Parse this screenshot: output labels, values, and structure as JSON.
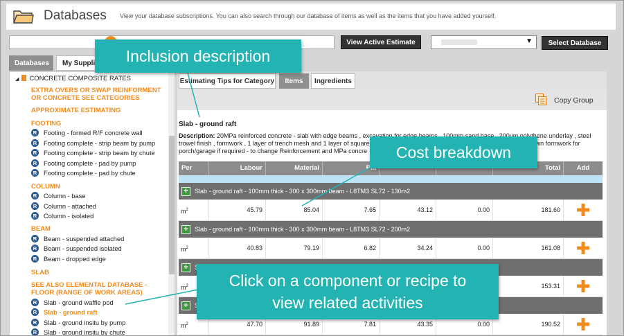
{
  "header": {
    "title": "Databases",
    "description": "View your database subscriptions. You can also search through our database of items as well as the items that you have added yourself."
  },
  "toolbar": {
    "view_estimate_label": "View Active Estimate",
    "select_db_label": "Select Database"
  },
  "left_tabs": {
    "databases": "Databases",
    "suppliers": "My Supplie"
  },
  "tree": {
    "root_label": "CONCRETE COMPOSITE RATES",
    "categories": {
      "extra_overs": "EXTRA OVERS OR SWAP REINFORMENT OR CONCRETE SEE CATEGORIES",
      "approx": "APPROXIMATE ESTIMATING",
      "footing": "FOOTING",
      "column": "COLUMN",
      "beam": "BEAM",
      "slab": "SLAB",
      "see_also": "SEE ALSO ELEMENTAL DATABASE - FLOOR (RANGE OF WORK AREAS)"
    },
    "recipe_badge": "R",
    "items": [
      "Footing - formed R/F concrete wall",
      "Footing complete - strip beam by pump",
      "Footing complete - strip beam by chute",
      "Footing complete - pad by pump",
      "Footing complete - pad by chute",
      "Column - base",
      "Column - attached",
      "Column - isolated",
      "Beam - suspended attached",
      "Beam - suspended isolated",
      "Beam - dropped edge",
      "Slab - ground waffle pod",
      "Slab - ground raft",
      "Slab - ground insitu by pump",
      "Slab - ground insitu by chute"
    ]
  },
  "right_tabs": {
    "tips": "Estimating Tips for Category",
    "items": "Items",
    "ingredients": "Ingredients"
  },
  "copy_group_label": "Copy Group",
  "selected_title": "Slab - ground raft",
  "description": {
    "label": "Description:",
    "line1": "20MPa reinforced concrete - slab with edge beams , excavation for edge beams , 100mm sand base , 200um polythene underlay , steel",
    "line2": "trowel finish , formwork , 1 layer of trench mesh and 1 layer of square",
    "line2_end": "wn formwork for",
    "line3": "porch/garage if required - to change Reinforcement and MPa concre"
  },
  "table": {
    "headers": {
      "per": "Per",
      "labour": "Labour",
      "material": "Material",
      "plant": "Pla",
      "total": "Total",
      "add": "Add"
    },
    "groups": [
      "Slab - ground raft - 100mm thick - 300 x 300mm beam - L8TM3 SL72 - 130m2",
      "Slab - ground raft - 100mm thick - 300 x 300mm beam - L8TM3 SL72 - 200m2",
      "S",
      "S"
    ],
    "unit": "m",
    "unit_sup": "2",
    "rows": [
      {
        "labour": "45.79",
        "material": "85.04",
        "plant": "7.65",
        "col4": "43.12",
        "col5": "0.00",
        "total": "181.60"
      },
      {
        "labour": "40.83",
        "material": "79.19",
        "plant": "6.82",
        "col4": "34.24",
        "col5": "0.00",
        "total": "161.08"
      },
      {
        "labour": "",
        "material": "",
        "plant": "",
        "col4": "",
        "col5": "",
        "total": "153.31"
      },
      {
        "labour": "47.70",
        "material": "91.89",
        "plant": "7.81",
        "col4": "43.35",
        "col5": "0.00",
        "total": "190.52"
      }
    ]
  },
  "callouts": {
    "inclusion": "Inclusion description",
    "cost": "Cost breakdown",
    "click_line1": "Click on a component or recipe to",
    "click_line2": "view related activities"
  },
  "colors": {
    "orange": "#f08c1e",
    "teal": "#24b3b3",
    "recipe_blue": "#2b5a91",
    "header_gray": "#8c8c8c",
    "group_gray": "#6f6f6f"
  }
}
